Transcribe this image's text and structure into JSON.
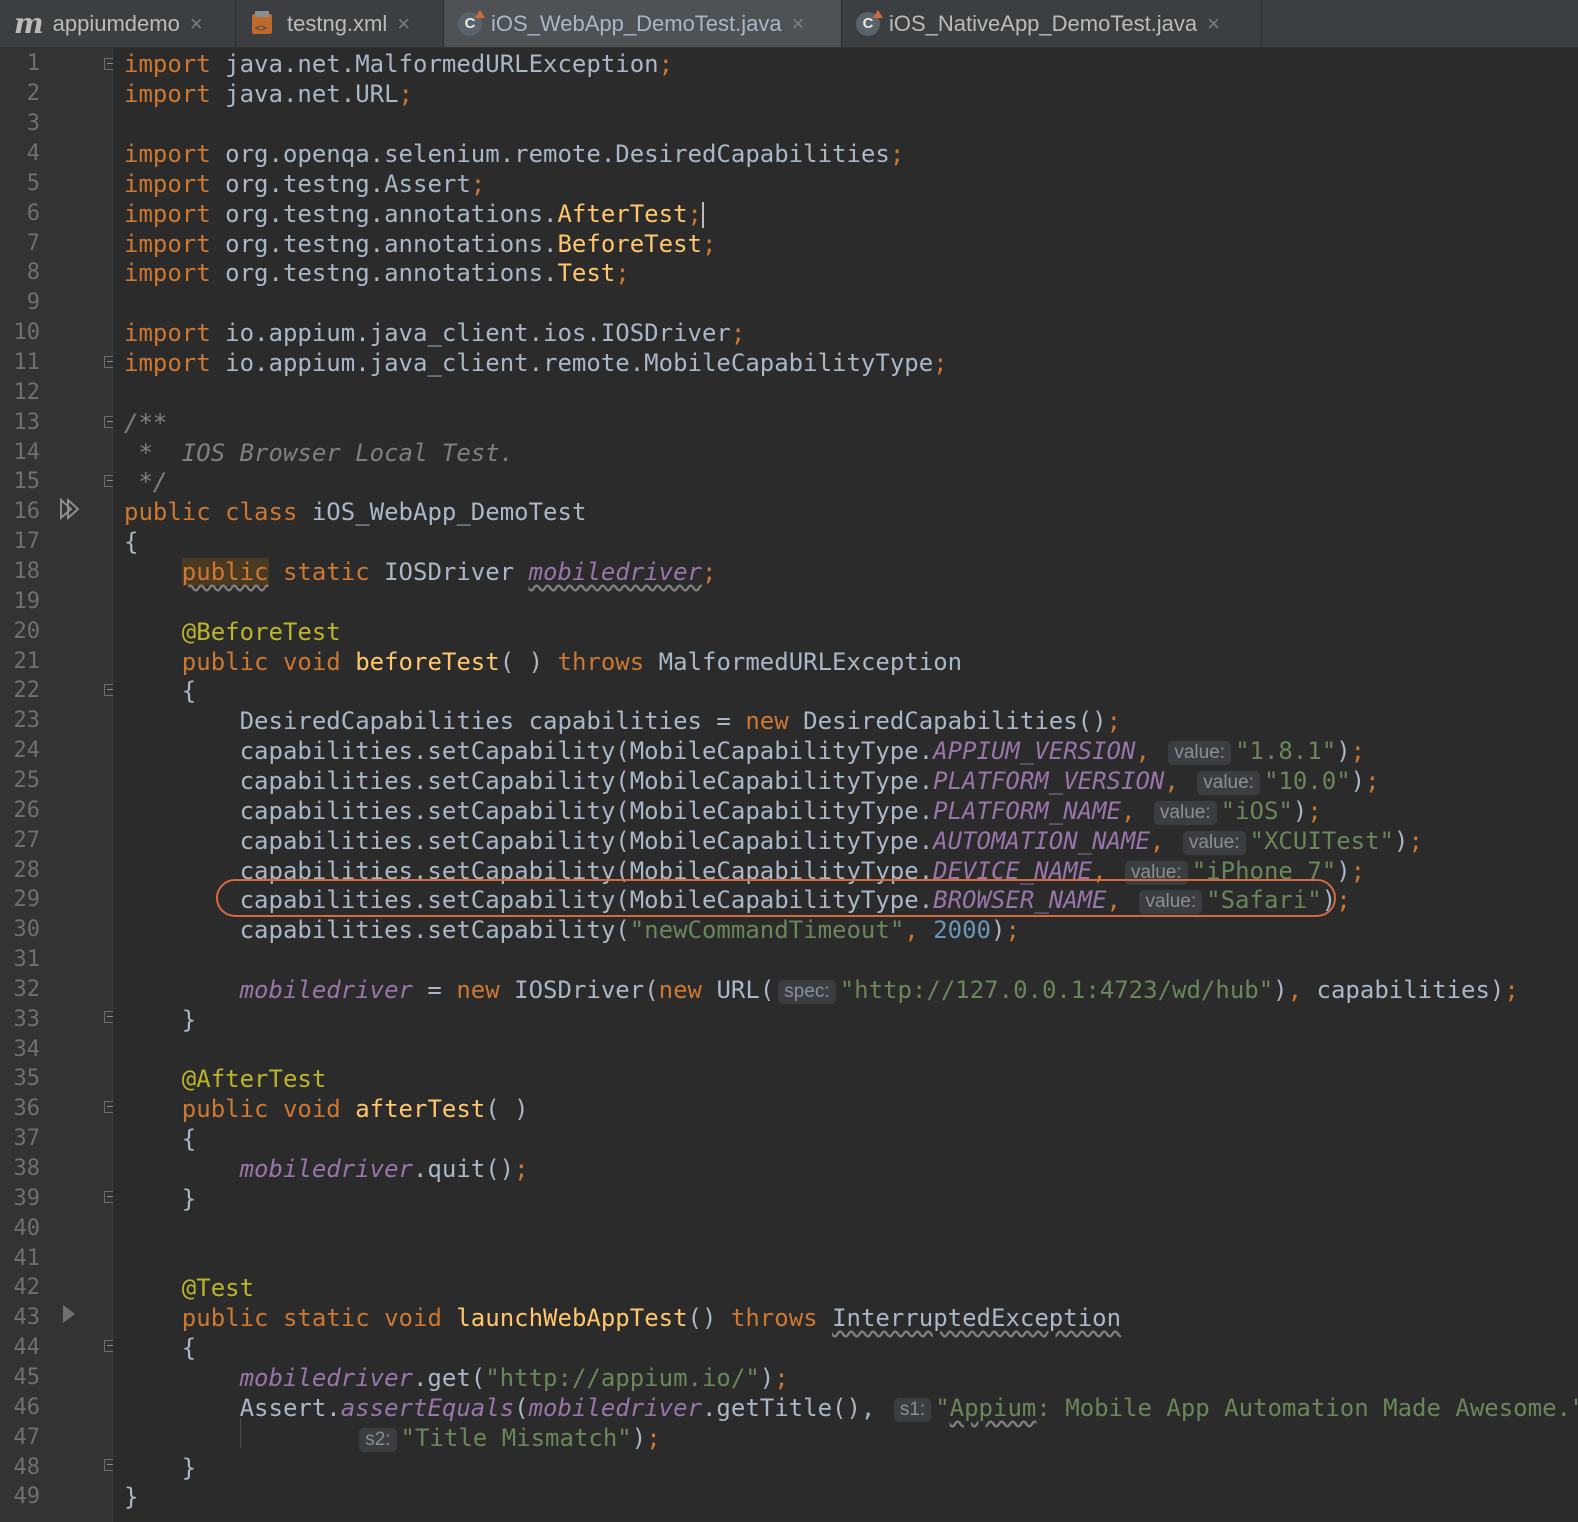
{
  "tabs": [
    {
      "label": "appiumdemo",
      "icon": "maven-module-icon"
    },
    {
      "label": "testng.xml",
      "icon": "xml-file-icon"
    },
    {
      "label": "iOS_WebApp_DemoTest.java",
      "icon": "java-class-icon",
      "active": true
    },
    {
      "label": "iOS_NativeApp_DemoTest.java",
      "icon": "java-class-icon"
    }
  ],
  "lines": {
    "n1": "1",
    "n2": "2",
    "n3": "3",
    "n4": "4",
    "n5": "5",
    "n6": "6",
    "n7": "7",
    "n8": "8",
    "n9": "9",
    "n10": "10",
    "n11": "11",
    "n12": "12",
    "n13": "13",
    "n14": "14",
    "n15": "15",
    "n16": "16",
    "n17": "17",
    "n18": "18",
    "n19": "19",
    "n20": "20",
    "n21": "21",
    "n22": "22",
    "n23": "23",
    "n24": "24",
    "n25": "25",
    "n26": "26",
    "n27": "27",
    "n28": "28",
    "n29": "29",
    "n30": "30",
    "n31": "31",
    "n32": "32",
    "n33": "33",
    "n34": "34",
    "n35": "35",
    "n36": "36",
    "n37": "37",
    "n38": "38",
    "n39": "39",
    "n40": "40",
    "n41": "41",
    "n42": "42",
    "n43": "43",
    "n44": "44",
    "n45": "45",
    "n46": "46",
    "n47": "47",
    "n48": "48",
    "n49": "49"
  },
  "code": {
    "kw_import": "import",
    "kw_public": "public",
    "kw_class": "class",
    "kw_static": "static",
    "kw_void": "void",
    "kw_throws": "throws",
    "kw_new": "new",
    "semi": ";",
    "l1_pkg": " java.net.MalformedURLException",
    "l2_pkg": " java.net.URL",
    "l4_pkg": " org.openqa.selenium.remote.DesiredCapabilities",
    "l5_pkg": " org.testng.Assert",
    "l6_pkg": " org.testng.annotations.",
    "l6_cls": "AfterTest",
    "l7_pkg": " org.testng.annotations.",
    "l7_cls": "BeforeTest",
    "l8_pkg": " org.testng.annotations.",
    "l8_cls": "Test",
    "l10_pkg": " io.appium.java_client.ios.IOSDriver",
    "l11_pkg": " io.appium.java_client.remote.MobileCapabilityType",
    "l13": "/**",
    "l14": " *  IOS Browser Local Test.",
    "l15": " */",
    "l16_name": " iOS_WebApp_DemoTest",
    "brace_open": "{",
    "brace_close": "}",
    "l18_type": " IOSDriver ",
    "field": "mobiledriver",
    "ann_before": "@BeforeTest",
    "l21_fn": "beforeTest",
    "l21_params": "( ) ",
    "l21_ex": " MalformedURLException",
    "l23_a": "DesiredCapabilities capabilities = ",
    "l23_b": " DesiredCapabilities()",
    "setcap": "capabilities.setCapability(MobileCapabilityType.",
    "comma": ", ",
    "close_paren": ")",
    "hint_value": "value:",
    "c_appium_version": "APPIUM_VERSION",
    "v_appium_version": "\"1.8.1\"",
    "c_platform_version": "PLATFORM_VERSION",
    "v_platform_version": "\"10.0\"",
    "c_platform_name": "PLATFORM_NAME",
    "v_platform_name": "\"iOS\"",
    "c_automation_name": "AUTOMATION_NAME",
    "v_automation_name": "\"XCUITest\"",
    "c_device_name": "DEVICE_NAME",
    "v_device_name": "\"iPhone 7\"",
    "c_browser_name": "BROWSER_NAME",
    "v_browser_name": "\"Safari\"",
    "l30_a": "capabilities.setCapability(",
    "l30_str": "\"newCommandTimeout\"",
    "l30_num": "2000",
    "l32_eq": " = ",
    "l32_driver": " IOSDriver(",
    "l32_url": " URL(",
    "hint_spec": "spec:",
    "l32_str": "\"http://127.0.0.1:4723/wd/hub\"",
    "l32_end": "capabilities)",
    "ann_after": "@AfterTest",
    "l36_fn": "afterTest",
    "l36_params": "( )",
    "l38_call": ".quit()",
    "ann_test": "@Test",
    "l43_fn": "launchWebAppTest",
    "l43_params": "() ",
    "l43_ex": "InterruptedException",
    "l45_call": ".get(",
    "l45_str": "\"http://appium.io/\"",
    "l46_a": "Assert.",
    "l46_fn": "assertEquals",
    "l46_b": "(",
    "l46_c": ".getTitle(), ",
    "hint_s1": "s1:",
    "l46_str_q": "\"",
    "l46_str_w": "Appium",
    "l46_str_rest": ": Mobile App Automation Made Awesome.\"",
    "l46_comma": ",",
    "hint_s2": "s2:",
    "l47_str": "\"Title Mismatch\"",
    "l47_end": ")"
  }
}
